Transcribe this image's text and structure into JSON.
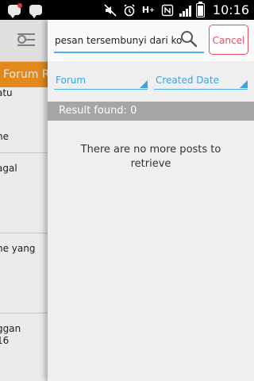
{
  "status_bar": {
    "time": "10:16",
    "icons": [
      "bbm-icon",
      "chat-icon",
      "mute-icon",
      "alarm-icon",
      "hplus-icon",
      "nfc-icon",
      "signal-icon",
      "battery-icon"
    ]
  },
  "drawer": {
    "orange_label": "Forum R",
    "items": [
      {
        "text": "atu"
      },
      {
        "text": "ne"
      },
      {
        "text": "agal"
      },
      {
        "text": "ne yang"
      },
      {
        "text": "ggan"
      },
      {
        "text": "16"
      }
    ]
  },
  "search": {
    "value": "pesan tersembunyi dari ko",
    "cancel_label": "Cancel"
  },
  "filters": {
    "forum_label": "Forum",
    "date_label": "Created Date"
  },
  "results": {
    "summary": "Result found: 0",
    "empty_message": "There are no more posts to retrieve"
  },
  "colors": {
    "accent_blue": "#3aa3e0",
    "cancel_red": "#e0505a",
    "drawer_orange": "#f7941d",
    "result_bar": "#a5a5a5"
  }
}
